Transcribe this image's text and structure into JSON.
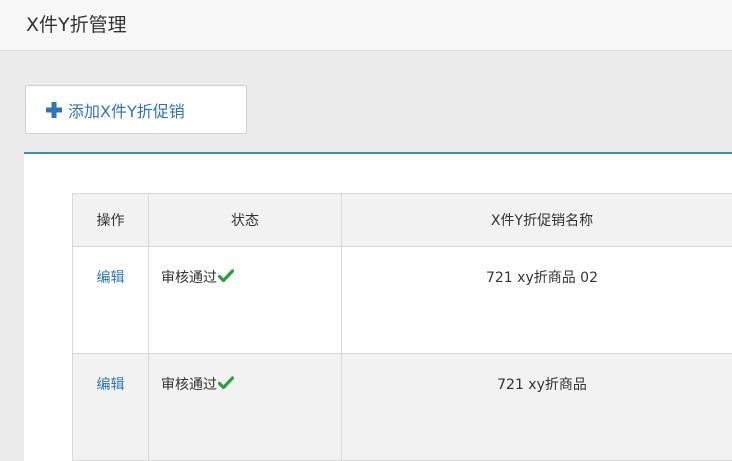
{
  "header": {
    "title": "X件Y折管理"
  },
  "toolbar": {
    "add_label": "添加X件Y折促销",
    "add_icon": "plus-icon"
  },
  "table": {
    "columns": [
      "操作",
      "状态",
      "X件Y折促销名称"
    ],
    "rows": [
      {
        "action": "编辑",
        "status": "审核通过",
        "status_icon": "check-icon",
        "name": "721 xy折商品 02"
      },
      {
        "action": "编辑",
        "status": "审核通过",
        "status_icon": "check-icon",
        "name": "721 xy折商品"
      }
    ]
  },
  "colors": {
    "link": "#2f74b5",
    "check": "#2e9e3a",
    "panel_accent": "#3c8dbc",
    "header_bg": "#f8f8f8",
    "page_bg": "#ececec"
  }
}
